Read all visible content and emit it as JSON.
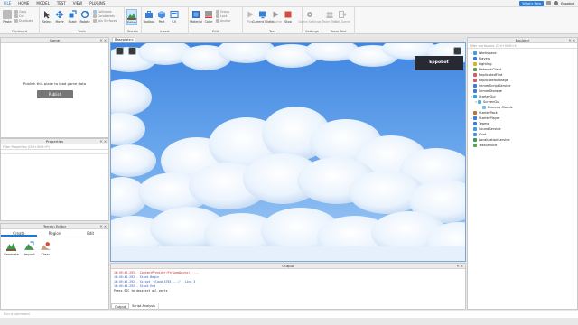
{
  "menu": {
    "items": [
      "FILE",
      "HOME",
      "MODEL",
      "TEST",
      "VIEW",
      "PLUGINS"
    ],
    "whats_new": "What's New",
    "user": "Eppobot"
  },
  "ribbon": {
    "clipboard": {
      "label": "Clipboard",
      "paste": "Paste",
      "copy": "Copy",
      "cut": "Cut",
      "duplicate": "Duplicate"
    },
    "tools": {
      "label": "Tools",
      "select": "Select",
      "move": "Move",
      "scale": "Scale",
      "rotate": "Rotate",
      "collisions": "Collisions",
      "constraints": "Constraints",
      "join": "Join Surfaces"
    },
    "terrain": {
      "label": "Terrain",
      "editor": "Editor"
    },
    "insert": {
      "label": "Insert",
      "toolbox": "Toolbox",
      "part": "Part",
      "ui": "UI"
    },
    "edit": {
      "label": "Edit",
      "material": "Material",
      "color": "Color",
      "group": "Group",
      "lock": "Lock",
      "anchor": "Anchor"
    },
    "test": {
      "label": "Test",
      "play": "Play",
      "current": "Current Client",
      "resume": "Resume",
      "stop": "Stop"
    },
    "settings": {
      "label": "Settings",
      "game_settings": "Game Settings"
    },
    "teamtest": {
      "label": "Team Test",
      "team_test": "Team Test",
      "exit_game": "Exit Game"
    }
  },
  "game_panel": {
    "title": "Game",
    "message": "Publish this place to load game data",
    "publish": "Publish"
  },
  "properties_panel": {
    "title": "Properties",
    "filter_placeholder": "Filter Properties (Ctrl+Shift+P)"
  },
  "terrain_panel": {
    "title": "Terrain Editor",
    "tabs": [
      "Create",
      "Region",
      "Edit"
    ],
    "tools": [
      "Generate",
      "Import",
      "Clear"
    ]
  },
  "viewport": {
    "tab": "Baseplate",
    "username": "Eppobot"
  },
  "output_panel": {
    "title": "Output",
    "lines": [
      {
        "text": "16:49:46.292 - ContentProvider:PreloadAsync() ..."
      },
      {
        "text": "16:49:46.292 - Stack Begin"
      },
      {
        "text": "16:49:46.292 - Script 'cloud_4763(...)', Line 3"
      },
      {
        "text": "16:49:46.292 - Stack End"
      },
      {
        "text": "Press ESC to deselect all parts"
      }
    ],
    "tabs": [
      "Output",
      "Script Analysis"
    ]
  },
  "explorer": {
    "title": "Explorer",
    "filter_placeholder": "Filter workspace (Ctrl+Shift+X)",
    "nodes": [
      {
        "label": "Workspace",
        "depth": 0,
        "color": "#3aa0e0",
        "arrow": "▸"
      },
      {
        "label": "Players",
        "depth": 0,
        "color": "#3a7fd6",
        "arrow": ""
      },
      {
        "label": "Lighting",
        "depth": 0,
        "color": "#e0b020",
        "arrow": ""
      },
      {
        "label": "NetworkClient",
        "depth": 0,
        "color": "#5aa05a",
        "arrow": ""
      },
      {
        "label": "ReplicatedFirst",
        "depth": 0,
        "color": "#d06060",
        "arrow": ""
      },
      {
        "label": "ReplicatedStorage",
        "depth": 0,
        "color": "#d06060",
        "arrow": ""
      },
      {
        "label": "ServerScriptService",
        "depth": 0,
        "color": "#3a7fd6",
        "arrow": ""
      },
      {
        "label": "ServerStorage",
        "depth": 0,
        "color": "#3a7fd6",
        "arrow": ""
      },
      {
        "label": "StarterGui",
        "depth": 0,
        "color": "#3aa0e0",
        "arrow": "▾"
      },
      {
        "label": "ScreenGui",
        "depth": 1,
        "color": "#4ab0e0",
        "arrow": "▾"
      },
      {
        "label": "Dreamy Clouds",
        "depth": 2,
        "color": "#7ac0e8",
        "arrow": ""
      },
      {
        "label": "StarterPack",
        "depth": 0,
        "color": "#c07030",
        "arrow": ""
      },
      {
        "label": "StarterPlayer",
        "depth": 0,
        "color": "#3a7fd6",
        "arrow": "▸"
      },
      {
        "label": "Teams",
        "depth": 0,
        "color": "#3a7fd6",
        "arrow": ""
      },
      {
        "label": "SoundService",
        "depth": 0,
        "color": "#3aa0e0",
        "arrow": ""
      },
      {
        "label": "Chat",
        "depth": 0,
        "color": "#5a8ad6",
        "arrow": "▸"
      },
      {
        "label": "LocalizationService",
        "depth": 0,
        "color": "#3a9a5a",
        "arrow": ""
      },
      {
        "label": "TestService",
        "depth": 0,
        "color": "#5aa05a",
        "arrow": ""
      }
    ]
  },
  "command_bar": {
    "placeholder": "Run a command"
  },
  "colors": {
    "accent": "#1a7bd6",
    "sky_top": "#3f86e2",
    "sky_bottom": "#8fc2f5"
  }
}
